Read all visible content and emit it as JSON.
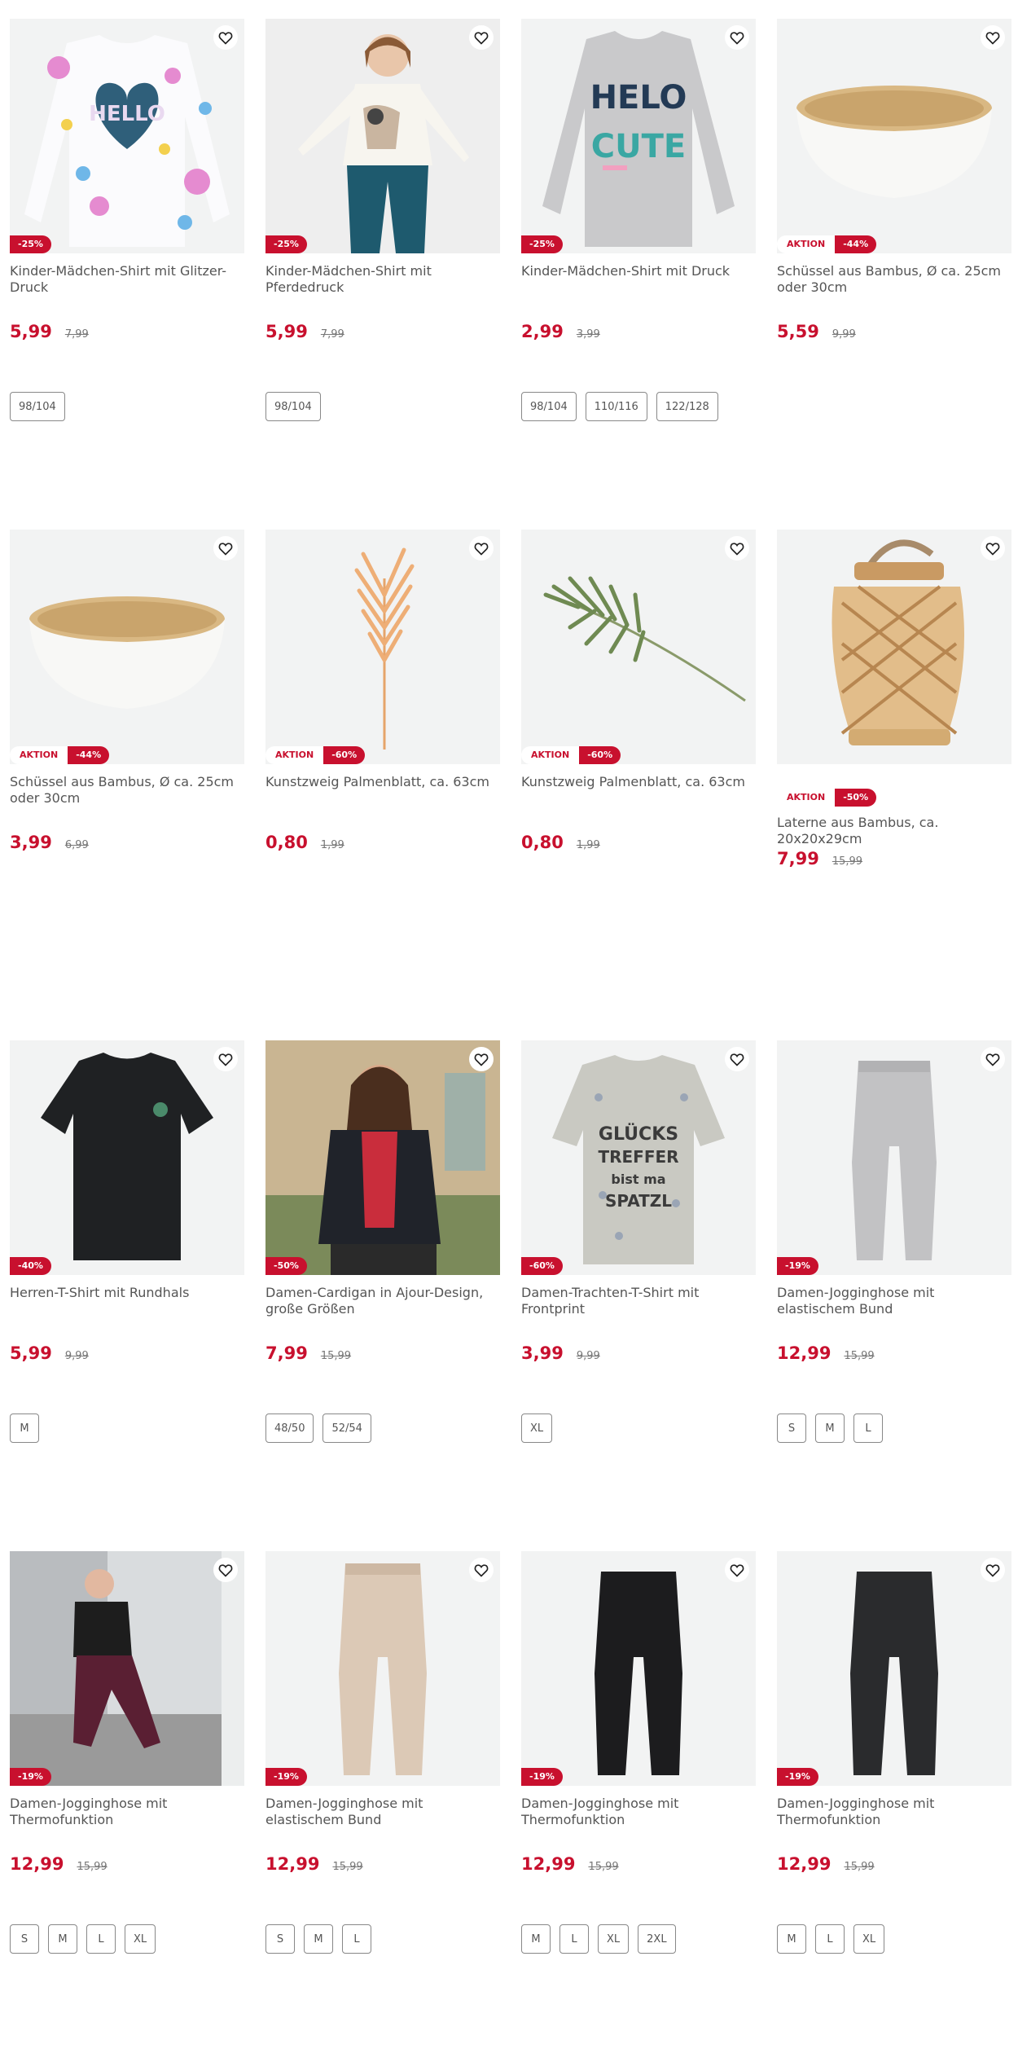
{
  "colors": {
    "accent": "#c8102e",
    "image_bg": "#f2f3f3"
  },
  "products": [
    {
      "title": "Kinder-Mädchen-Shirt mit Glitzer-Druck",
      "price": "5,99",
      "old_price": "7,99",
      "discount": "-25%",
      "aktion": "",
      "sizes": [
        "98/104"
      ],
      "icon": "girls-shirt-hello-heart"
    },
    {
      "title": "Kinder-Mädchen-Shirt mit Pferdedruck",
      "price": "5,99",
      "old_price": "7,99",
      "discount": "-25%",
      "aktion": "",
      "sizes": [
        "98/104"
      ],
      "icon": "girl-model-horse-shirt"
    },
    {
      "title": "Kinder-Mädchen-Shirt mit Druck",
      "price": "2,99",
      "old_price": "3,99",
      "discount": "-25%",
      "aktion": "",
      "sizes": [
        "98/104",
        "110/116",
        "122/128"
      ],
      "icon": "grey-shirt-hello-cute"
    },
    {
      "title": "Schüssel aus Bambus, Ø ca. 25cm oder 30cm",
      "price": "5,59",
      "old_price": "9,99",
      "discount": "-44%",
      "aktion": "AKTION",
      "sizes": [],
      "icon": "bamboo-bowl"
    },
    {
      "title": "Schüssel aus Bambus, Ø ca. 25cm oder 30cm",
      "price": "3,99",
      "old_price": "6,99",
      "discount": "-44%",
      "aktion": "AKTION",
      "sizes": [],
      "icon": "bamboo-bowl"
    },
    {
      "title": "Kunstzweig Palmenblatt, ca. 63cm",
      "price": "0,80",
      "old_price": "1,99",
      "discount": "-60%",
      "aktion": "AKTION",
      "sizes": [],
      "icon": "orange-palm-leaf"
    },
    {
      "title": "Kunstzweig Palmenblatt, ca. 63cm",
      "price": "0,80",
      "old_price": "1,99",
      "discount": "-60%",
      "aktion": "AKTION",
      "sizes": [],
      "icon": "green-palm-leaf"
    },
    {
      "title": "Laterne aus Bambus, ca. 20x20x29cm",
      "price": "7,99",
      "old_price": "15,99",
      "discount": "-50%",
      "aktion": "AKTION",
      "sizes": [],
      "icon": "bamboo-lantern",
      "badge_below": true
    },
    {
      "title": "Herren-T-Shirt mit Rundhals",
      "price": "5,99",
      "old_price": "9,99",
      "discount": "-40%",
      "aktion": "",
      "sizes": [
        "M"
      ],
      "icon": "black-tshirt"
    },
    {
      "title": "Damen-Cardigan in Ajour-Design, große Größen",
      "price": "7,99",
      "old_price": "15,99",
      "discount": "-50%",
      "aktion": "",
      "sizes": [
        "48/50",
        "52/54"
      ],
      "icon": "woman-cardigan-photo"
    },
    {
      "title": "Damen-Trachten-T-Shirt mit Frontprint",
      "price": "3,99",
      "old_price": "9,99",
      "discount": "-60%",
      "aktion": "",
      "sizes": [
        "XL"
      ],
      "icon": "floral-tshirt",
      "print": [
        "GLÜCKS",
        "TREFFER",
        "bist ma",
        "SPATZL"
      ]
    },
    {
      "title": "Damen-Jogginghose mit elastischem Bund",
      "price": "12,99",
      "old_price": "15,99",
      "discount": "-19%",
      "aktion": "",
      "sizes": [
        "S",
        "M",
        "L"
      ],
      "icon": "grey-jogging-pants"
    },
    {
      "title": "Damen-Jogginghose mit Thermofunktion",
      "price": "12,99",
      "old_price": "15,99",
      "discount": "-19%",
      "aktion": "",
      "sizes": [
        "S",
        "M",
        "L",
        "XL"
      ],
      "icon": "woman-sport-photo"
    },
    {
      "title": "Damen-Jogginghose mit elastischem Bund",
      "price": "12,99",
      "old_price": "15,99",
      "discount": "-19%",
      "aktion": "",
      "sizes": [
        "S",
        "M",
        "L"
      ],
      "icon": "beige-jogging-pants"
    },
    {
      "title": "Damen-Jogginghose mit Thermofunktion",
      "price": "12,99",
      "old_price": "15,99",
      "discount": "-19%",
      "aktion": "",
      "sizes": [
        "M",
        "L",
        "XL",
        "2XL"
      ],
      "icon": "black-jogging-pants"
    },
    {
      "title": "Damen-Jogginghose mit Thermofunktion",
      "price": "12,99",
      "old_price": "15,99",
      "discount": "-19%",
      "aktion": "",
      "sizes": [
        "M",
        "L",
        "XL"
      ],
      "icon": "dark-jogging-pants"
    }
  ]
}
